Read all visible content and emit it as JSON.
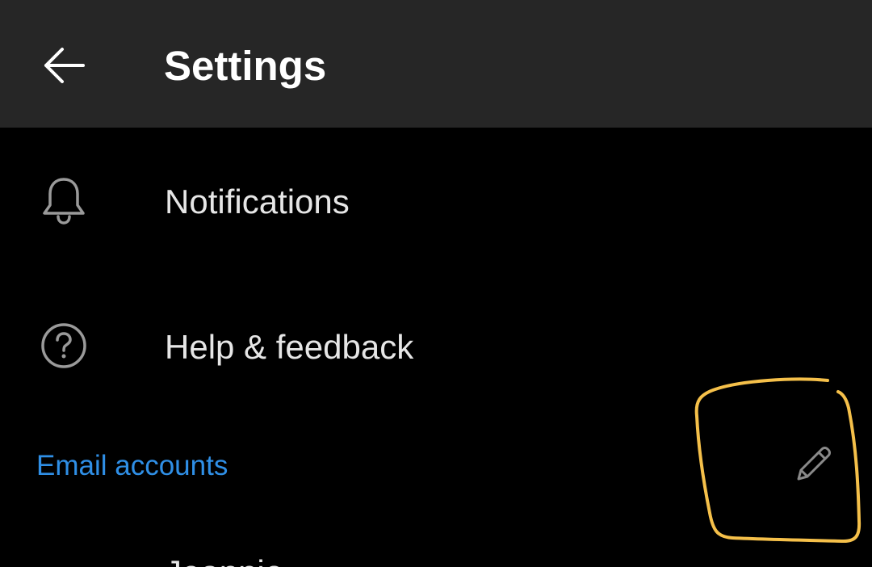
{
  "header": {
    "title": "Settings",
    "back_icon": "arrow-left-icon"
  },
  "menu": {
    "items": [
      {
        "label": "Notifications",
        "icon": "bell-icon"
      },
      {
        "label": "Help & feedback",
        "icon": "help-circle-icon"
      }
    ]
  },
  "email_accounts": {
    "section_label": "Email accounts",
    "edit_icon": "pencil-icon",
    "accounts": [
      {
        "name": "Jeannie"
      }
    ]
  },
  "colors": {
    "app_bar": "#262626",
    "background": "#000000",
    "accent": "#2f8fe6",
    "annotation": "#f5c04a"
  }
}
